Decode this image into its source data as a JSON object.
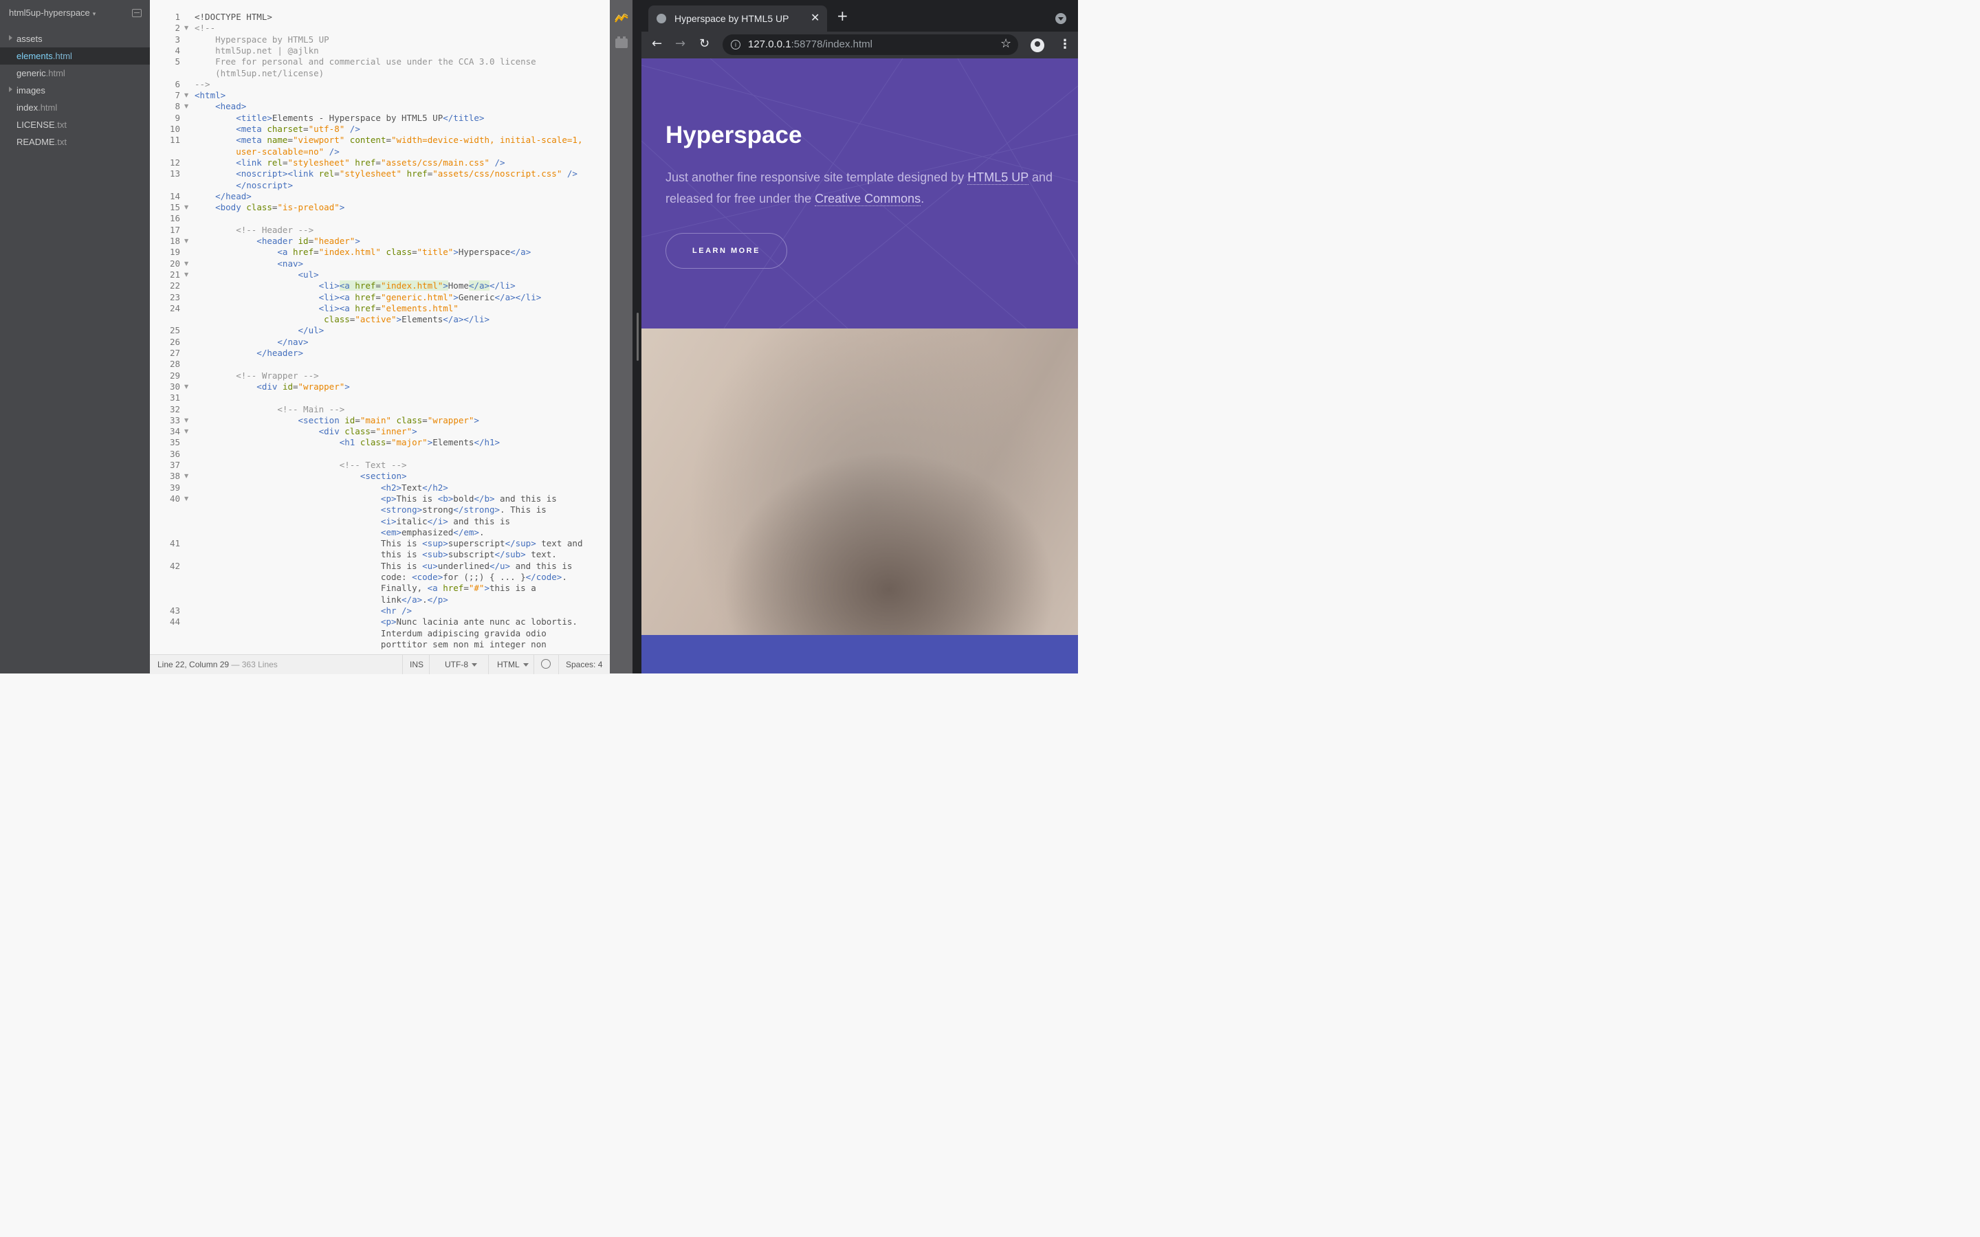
{
  "sidebar": {
    "project_name": "html5up-hyperspace",
    "items": [
      {
        "type": "folder",
        "name": "assets",
        "ext": ""
      },
      {
        "type": "file",
        "name": "elements",
        "ext": ".html",
        "selected": true
      },
      {
        "type": "file",
        "name": "generic",
        "ext": ".html"
      },
      {
        "type": "folder",
        "name": "images",
        "ext": ""
      },
      {
        "type": "file",
        "name": "index",
        "ext": ".html"
      },
      {
        "type": "file",
        "name": "LICENSE",
        "ext": ".txt"
      },
      {
        "type": "file",
        "name": "README",
        "ext": ".txt"
      }
    ]
  },
  "editor": {
    "lines": [
      {
        "n": "1",
        "fold": false,
        "segs": [
          [
            "x",
            "<!DOCTYPE HTML>"
          ]
        ]
      },
      {
        "n": "2",
        "fold": true,
        "segs": [
          [
            "c",
            "<!--"
          ]
        ]
      },
      {
        "n": "3",
        "fold": false,
        "segs": [
          [
            "c",
            "    Hyperspace by HTML5 UP"
          ]
        ]
      },
      {
        "n": "4",
        "fold": false,
        "segs": [
          [
            "c",
            "    html5up.net | @ajlkn"
          ]
        ]
      },
      {
        "n": "5",
        "fold": false,
        "segs": [
          [
            "c",
            "    Free for personal and commercial use under the CCA 3.0 license"
          ]
        ]
      },
      {
        "n": "",
        "fold": false,
        "segs": [
          [
            "c",
            "    (html5up.net/license)"
          ]
        ]
      },
      {
        "n": "6",
        "fold": false,
        "segs": [
          [
            "c",
            "-->"
          ]
        ]
      },
      {
        "n": "7",
        "fold": true,
        "segs": [
          [
            "t",
            "<html>"
          ]
        ]
      },
      {
        "n": "8",
        "fold": true,
        "segs": [
          [
            "t",
            "    <head>"
          ]
        ]
      },
      {
        "n": "9",
        "fold": false,
        "segs": [
          [
            "t",
            "        <title>"
          ],
          [
            "x",
            "Elements - Hyperspace by HTML5 UP"
          ],
          [
            "t",
            "</title>"
          ]
        ]
      },
      {
        "n": "10",
        "fold": false,
        "segs": [
          [
            "t",
            "        <meta "
          ],
          [
            "a",
            "charset"
          ],
          [
            "x",
            "="
          ],
          [
            "v",
            "\"utf-8\""
          ],
          [
            "t",
            " />"
          ]
        ]
      },
      {
        "n": "11",
        "fold": false,
        "segs": [
          [
            "t",
            "        <meta "
          ],
          [
            "a",
            "name"
          ],
          [
            "x",
            "="
          ],
          [
            "v",
            "\"viewport\""
          ],
          [
            "a",
            " content"
          ],
          [
            "x",
            "="
          ],
          [
            "v",
            "\"width=device-width, initial-scale=1,"
          ]
        ]
      },
      {
        "n": "",
        "fold": false,
        "segs": [
          [
            "v",
            "        user-scalable=no\""
          ],
          [
            "t",
            " />"
          ]
        ]
      },
      {
        "n": "12",
        "fold": false,
        "segs": [
          [
            "t",
            "        <link "
          ],
          [
            "a",
            "rel"
          ],
          [
            "x",
            "="
          ],
          [
            "v",
            "\"stylesheet\""
          ],
          [
            "a",
            " href"
          ],
          [
            "x",
            "="
          ],
          [
            "v",
            "\"assets/css/main.css\""
          ],
          [
            "t",
            " />"
          ]
        ]
      },
      {
        "n": "13",
        "fold": false,
        "segs": [
          [
            "t",
            "        <noscript><link "
          ],
          [
            "a",
            "rel"
          ],
          [
            "x",
            "="
          ],
          [
            "v",
            "\"stylesheet\""
          ],
          [
            "a",
            " href"
          ],
          [
            "x",
            "="
          ],
          [
            "v",
            "\"assets/css/noscript.css\""
          ],
          [
            "t",
            " />"
          ]
        ]
      },
      {
        "n": "",
        "fold": false,
        "segs": [
          [
            "t",
            "        </noscript>"
          ]
        ]
      },
      {
        "n": "14",
        "fold": false,
        "segs": [
          [
            "t",
            "    </head>"
          ]
        ]
      },
      {
        "n": "15",
        "fold": true,
        "segs": [
          [
            "t",
            "    <body "
          ],
          [
            "a",
            "class"
          ],
          [
            "x",
            "="
          ],
          [
            "v",
            "\"is-preload\""
          ],
          [
            "t",
            ">"
          ]
        ]
      },
      {
        "n": "16",
        "fold": false,
        "segs": [
          [
            "x",
            ""
          ]
        ]
      },
      {
        "n": "17",
        "fold": false,
        "segs": [
          [
            "c",
            "        <!-- Header -->"
          ]
        ]
      },
      {
        "n": "18",
        "fold": true,
        "segs": [
          [
            "t",
            "            <header "
          ],
          [
            "a",
            "id"
          ],
          [
            "x",
            "="
          ],
          [
            "v",
            "\"header\""
          ],
          [
            "t",
            ">"
          ]
        ]
      },
      {
        "n": "19",
        "fold": false,
        "segs": [
          [
            "t",
            "                <a "
          ],
          [
            "a",
            "href"
          ],
          [
            "x",
            "="
          ],
          [
            "v",
            "\"index.html\""
          ],
          [
            "a",
            " class"
          ],
          [
            "x",
            "="
          ],
          [
            "v",
            "\"title\""
          ],
          [
            "t",
            ">"
          ],
          [
            "x",
            "Hyperspace"
          ],
          [
            "t",
            "</a>"
          ]
        ]
      },
      {
        "n": "20",
        "fold": true,
        "segs": [
          [
            "t",
            "                <nav>"
          ]
        ]
      },
      {
        "n": "21",
        "fold": true,
        "segs": [
          [
            "t",
            "                    <ul>"
          ]
        ]
      },
      {
        "n": "22",
        "fold": false,
        "segs": [
          [
            "t",
            "                        <li>"
          ],
          [
            "th",
            "<a "
          ],
          [
            "ah",
            "href"
          ],
          [
            "xh",
            "="
          ],
          [
            "vh",
            "\"index.html\""
          ],
          [
            "th",
            ">"
          ],
          [
            "x",
            "Home"
          ],
          [
            "th",
            "</a>"
          ],
          [
            "t",
            "</li>"
          ]
        ]
      },
      {
        "n": "23",
        "fold": false,
        "segs": [
          [
            "t",
            "                        <li><a "
          ],
          [
            "a",
            "href"
          ],
          [
            "x",
            "="
          ],
          [
            "v",
            "\"generic.html\""
          ],
          [
            "t",
            ">"
          ],
          [
            "x",
            "Generic"
          ],
          [
            "t",
            "</a></li>"
          ]
        ]
      },
      {
        "n": "24",
        "fold": false,
        "segs": [
          [
            "t",
            "                        <li><a "
          ],
          [
            "a",
            "href"
          ],
          [
            "x",
            "="
          ],
          [
            "v",
            "\"elements.html\""
          ]
        ]
      },
      {
        "n": "",
        "fold": false,
        "segs": [
          [
            "a",
            "                         class"
          ],
          [
            "x",
            "="
          ],
          [
            "v",
            "\"active\""
          ],
          [
            "t",
            ">"
          ],
          [
            "x",
            "Elements"
          ],
          [
            "t",
            "</a></li>"
          ]
        ]
      },
      {
        "n": "25",
        "fold": false,
        "segs": [
          [
            "t",
            "                    </ul>"
          ]
        ]
      },
      {
        "n": "26",
        "fold": false,
        "segs": [
          [
            "t",
            "                </nav>"
          ]
        ]
      },
      {
        "n": "27",
        "fold": false,
        "segs": [
          [
            "t",
            "            </header>"
          ]
        ]
      },
      {
        "n": "28",
        "fold": false,
        "segs": [
          [
            "x",
            ""
          ]
        ]
      },
      {
        "n": "29",
        "fold": false,
        "segs": [
          [
            "c",
            "        <!-- Wrapper -->"
          ]
        ]
      },
      {
        "n": "30",
        "fold": true,
        "segs": [
          [
            "t",
            "            <div "
          ],
          [
            "a",
            "id"
          ],
          [
            "x",
            "="
          ],
          [
            "v",
            "\"wrapper\""
          ],
          [
            "t",
            ">"
          ]
        ]
      },
      {
        "n": "31",
        "fold": false,
        "segs": [
          [
            "x",
            ""
          ]
        ]
      },
      {
        "n": "32",
        "fold": false,
        "segs": [
          [
            "c",
            "                <!-- Main -->"
          ]
        ]
      },
      {
        "n": "33",
        "fold": true,
        "segs": [
          [
            "t",
            "                    <section "
          ],
          [
            "a",
            "id"
          ],
          [
            "x",
            "="
          ],
          [
            "v",
            "\"main\""
          ],
          [
            "a",
            " class"
          ],
          [
            "x",
            "="
          ],
          [
            "v",
            "\"wrapper\""
          ],
          [
            "t",
            ">"
          ]
        ]
      },
      {
        "n": "34",
        "fold": true,
        "segs": [
          [
            "t",
            "                        <div "
          ],
          [
            "a",
            "class"
          ],
          [
            "x",
            "="
          ],
          [
            "v",
            "\"inner\""
          ],
          [
            "t",
            ">"
          ]
        ]
      },
      {
        "n": "35",
        "fold": false,
        "segs": [
          [
            "t",
            "                            <h1 "
          ],
          [
            "a",
            "class"
          ],
          [
            "x",
            "="
          ],
          [
            "v",
            "\"major\""
          ],
          [
            "t",
            ">"
          ],
          [
            "x",
            "Elements"
          ],
          [
            "t",
            "</h1>"
          ]
        ]
      },
      {
        "n": "36",
        "fold": false,
        "segs": [
          [
            "x",
            ""
          ]
        ]
      },
      {
        "n": "37",
        "fold": false,
        "segs": [
          [
            "c",
            "                            <!-- Text -->"
          ]
        ]
      },
      {
        "n": "38",
        "fold": true,
        "segs": [
          [
            "t",
            "                                <section>"
          ]
        ]
      },
      {
        "n": "39",
        "fold": false,
        "segs": [
          [
            "t",
            "                                    <h2>"
          ],
          [
            "x",
            "Text"
          ],
          [
            "t",
            "</h2>"
          ]
        ]
      },
      {
        "n": "40",
        "fold": true,
        "segs": [
          [
            "t",
            "                                    <p>"
          ],
          [
            "x",
            "This is "
          ],
          [
            "t",
            "<b>"
          ],
          [
            "x",
            "bold"
          ],
          [
            "t",
            "</b>"
          ],
          [
            "x",
            " and this is"
          ]
        ]
      },
      {
        "n": "",
        "fold": false,
        "segs": [
          [
            "t",
            "                                    <strong>"
          ],
          [
            "x",
            "strong"
          ],
          [
            "t",
            "</strong>"
          ],
          [
            "x",
            ". This is"
          ]
        ]
      },
      {
        "n": "",
        "fold": false,
        "segs": [
          [
            "t",
            "                                    <i>"
          ],
          [
            "x",
            "italic"
          ],
          [
            "t",
            "</i>"
          ],
          [
            "x",
            " and this is"
          ]
        ]
      },
      {
        "n": "",
        "fold": false,
        "segs": [
          [
            "t",
            "                                    <em>"
          ],
          [
            "x",
            "emphasized"
          ],
          [
            "t",
            "</em>"
          ],
          [
            "x",
            "."
          ]
        ]
      },
      {
        "n": "41",
        "fold": false,
        "segs": [
          [
            "x",
            "                                    This is "
          ],
          [
            "t",
            "<sup>"
          ],
          [
            "x",
            "superscript"
          ],
          [
            "t",
            "</sup>"
          ],
          [
            "x",
            " text and"
          ]
        ]
      },
      {
        "n": "",
        "fold": false,
        "segs": [
          [
            "x",
            "                                    this is "
          ],
          [
            "t",
            "<sub>"
          ],
          [
            "x",
            "subscript"
          ],
          [
            "t",
            "</sub>"
          ],
          [
            "x",
            " text."
          ]
        ]
      },
      {
        "n": "42",
        "fold": false,
        "segs": [
          [
            "x",
            "                                    This is "
          ],
          [
            "t",
            "<u>"
          ],
          [
            "x",
            "underlined"
          ],
          [
            "t",
            "</u>"
          ],
          [
            "x",
            " and this is"
          ]
        ]
      },
      {
        "n": "",
        "fold": false,
        "segs": [
          [
            "x",
            "                                    code: "
          ],
          [
            "t",
            "<code>"
          ],
          [
            "x",
            "for (;;) { ... }"
          ],
          [
            "t",
            "</code>"
          ],
          [
            "x",
            "."
          ]
        ]
      },
      {
        "n": "",
        "fold": false,
        "segs": [
          [
            "x",
            "                                    Finally, "
          ],
          [
            "t",
            "<a "
          ],
          [
            "a",
            "href"
          ],
          [
            "x",
            "="
          ],
          [
            "v",
            "\"#\""
          ],
          [
            "t",
            ">"
          ],
          [
            "x",
            "this is a"
          ]
        ]
      },
      {
        "n": "",
        "fold": false,
        "segs": [
          [
            "x",
            "                                    link"
          ],
          [
            "t",
            "</a>"
          ],
          [
            "x",
            "."
          ],
          [
            "t",
            "</p>"
          ]
        ]
      },
      {
        "n": "43",
        "fold": false,
        "segs": [
          [
            "t",
            "                                    <hr />"
          ]
        ]
      },
      {
        "n": "44",
        "fold": false,
        "segs": [
          [
            "t",
            "                                    <p>"
          ],
          [
            "x",
            "Nunc lacinia ante nunc ac lobortis."
          ]
        ]
      },
      {
        "n": "",
        "fold": false,
        "segs": [
          [
            "x",
            "                                    Interdum adipiscing gravida odio"
          ]
        ]
      },
      {
        "n": "",
        "fold": false,
        "segs": [
          [
            "x",
            "                                    porttitor sem non mi integer non"
          ]
        ]
      }
    ]
  },
  "status": {
    "position": "Line 22, Column 29",
    "line_count": " — 363 Lines",
    "mode": "INS",
    "encoding": "UTF-8",
    "language": "HTML",
    "spaces": "Spaces:  4"
  },
  "browser": {
    "tab_title": "Hyperspace by HTML5 UP",
    "tab_close": "✕",
    "new_tab": "+",
    "url_host": "127.0.0.1",
    "url_rest": ":58778/index.html",
    "back": "←",
    "forward": "→",
    "reload": "↻",
    "star": "☆",
    "menu": "⋮"
  },
  "page": {
    "title": "Hyperspace",
    "intro_1": "Just another fine responsive site template designed by ",
    "link_1": "HTML5 UP",
    "intro_2": " and released for free under the ",
    "link_2": "Creative Commons",
    "intro_3": ".",
    "button": "LEARN MORE"
  },
  "colors": {
    "hero_bg": "#5a47a3",
    "accent_file": "#7fd0f5",
    "tag": "#446fbd",
    "attr": "#6d8600",
    "value": "#e88501",
    "comment": "#949494"
  }
}
